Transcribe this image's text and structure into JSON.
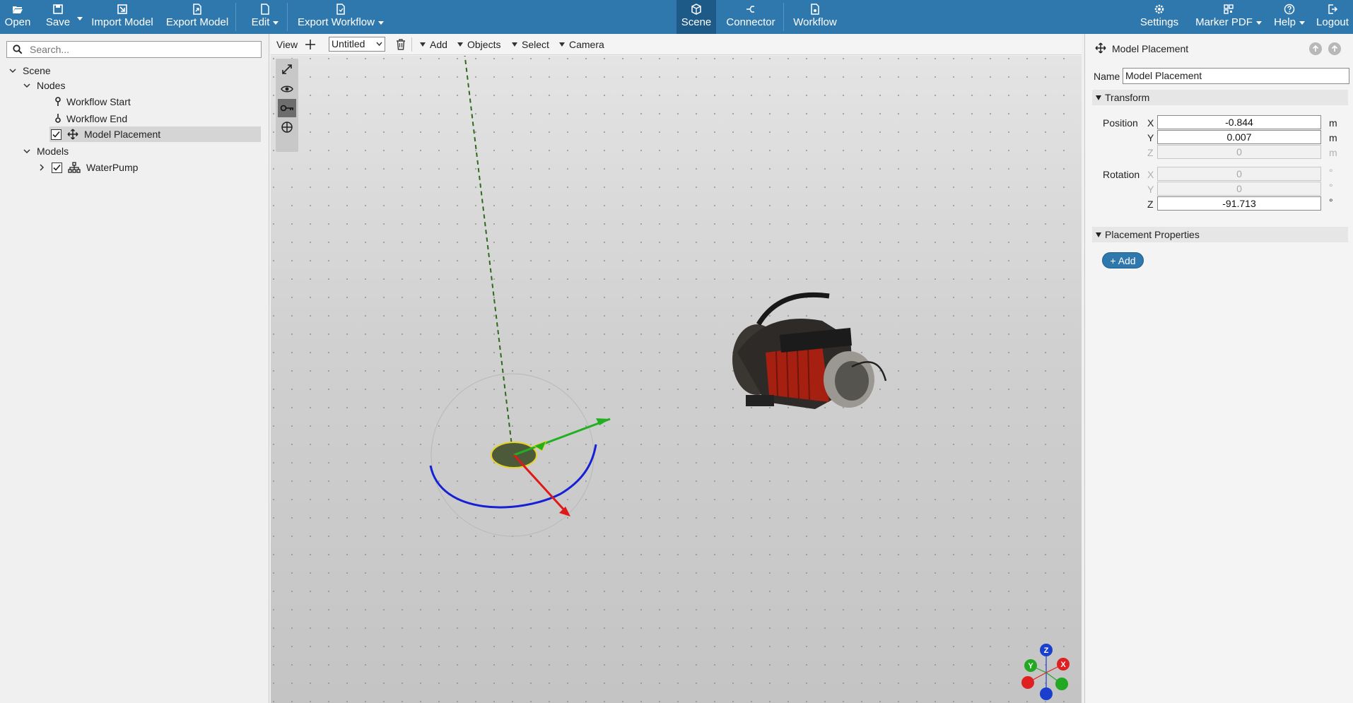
{
  "toolbar": {
    "open": "Open",
    "save": "Save",
    "import_model": "Import Model",
    "export_model": "Export Model",
    "edit": "Edit",
    "export_workflow": "Export Workflow",
    "scene": "Scene",
    "connector": "Connector",
    "workflow": "Workflow",
    "settings": "Settings",
    "marker_pdf": "Marker PDF",
    "help": "Help",
    "logout": "Logout"
  },
  "left": {
    "search_placeholder": "Search...",
    "tree": {
      "scene": "Scene",
      "nodes": "Nodes",
      "workflow_start": "Workflow Start",
      "workflow_end": "Workflow End",
      "model_placement": "Model Placement",
      "models": "Models",
      "waterpump": "WaterPump"
    }
  },
  "viewport_toolbar": {
    "view": "View",
    "view_selected": "Untitled",
    "add": "Add",
    "objects": "Objects",
    "select": "Select",
    "camera": "Camera"
  },
  "right": {
    "title": "Model Placement",
    "name_label": "Name",
    "name_value": "Model Placement",
    "transform": "Transform",
    "position_label": "Position",
    "rotation_label": "Rotation",
    "axis_x": "X",
    "axis_y": "Y",
    "axis_z": "Z",
    "pos_x": "-0.844",
    "pos_y": "0.007",
    "pos_z": "0",
    "rot_x": "0",
    "rot_y": "0",
    "rot_z": "-91.713",
    "unit_m": "m",
    "unit_deg": "°",
    "placement_properties": "Placement Properties",
    "add": "Add"
  },
  "gizmo": {
    "x": "X",
    "y": "Y",
    "z": "Z"
  },
  "colors": {
    "toolbar": "#2f78ad",
    "active_tab": "#1d5a88",
    "axis_x": "#e02020",
    "axis_y": "#22a822",
    "axis_z": "#1a3fcf"
  }
}
